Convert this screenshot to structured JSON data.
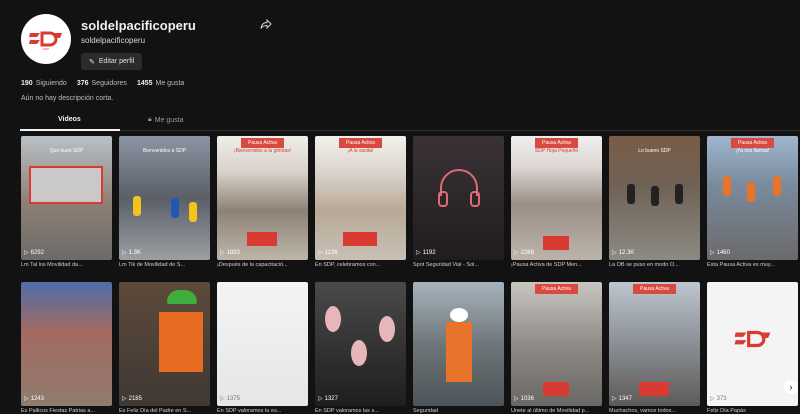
{
  "profile": {
    "username": "soldelpacificoperu",
    "handle": "soldelpacificoperu",
    "avatar_text": "SDP",
    "edit_button": "Editar perfil",
    "stats": [
      {
        "value": "190",
        "label": "Siguiendo"
      },
      {
        "value": "376",
        "label": "Seguidores"
      },
      {
        "value": "1455",
        "label": "Me gusta"
      }
    ],
    "bio": "Aún no hay descripción corta.",
    "icons": {
      "share": "share-icon",
      "edit": "edit-icon"
    }
  },
  "tabs": [
    {
      "label": "Videos",
      "active": true
    },
    {
      "label": "Me gusta",
      "active": false,
      "icon": "lock-icon"
    }
  ],
  "videos": [
    {
      "views": "6292",
      "caption": "Lm Tal los Movilidad da...",
      "banner": "",
      "subtitle": "Qué buen SDP"
    },
    {
      "views": "1.3K",
      "caption": "Lm Tik de Movilidad de S...",
      "banner": "",
      "subtitle": "Bienvenidos a SDP"
    },
    {
      "views": "1893",
      "caption": "¡Después de la capacitació...",
      "banner": "Pausa Activa",
      "subtitle": "¡Bienvenidos a la gimnas!"
    },
    {
      "views": "1136",
      "caption": "En SDP, celebramos con...",
      "banner": "Pausa Activa",
      "subtitle": "¡A la sasita!"
    },
    {
      "views": "1192",
      "caption": "Spot Seguridad Vial - Sol...",
      "banner": "",
      "subtitle": ""
    },
    {
      "views": "2268",
      "caption": "¡Pausa Activa de SDP Men...",
      "banner": "Pausa Activa",
      "subtitle": "SDP Hoja Pequeño"
    },
    {
      "views": "12.3K",
      "caption": "La OB se puso en modo O...",
      "banner": "",
      "subtitle": "Lo bueno SDP"
    },
    {
      "views": "1460",
      "caption": "Esta Pausa Activa es muy...",
      "banner": "Pausa Activa",
      "subtitle": "¡Ya nos llamas!"
    },
    {
      "views": "1243",
      "caption": "Es Pallicos Fiestas Patrias a...",
      "banner": "",
      "subtitle": ""
    },
    {
      "views": "2185",
      "caption": "Es Feliz Día del Padre en S...",
      "banner": "",
      "subtitle": ""
    },
    {
      "views": "1375",
      "caption": "En SDP valoramos tu es...",
      "banner": "",
      "subtitle": ""
    },
    {
      "views": "1327",
      "caption": "En SDP valoramos las s...",
      "banner": "",
      "subtitle": ""
    },
    {
      "views": "",
      "caption": "Seguridad",
      "banner": "",
      "subtitle": ""
    },
    {
      "views": "1036",
      "caption": "Únete al último de Movilidad p...",
      "banner": "Pausa Activa",
      "subtitle": ""
    },
    {
      "views": "1347",
      "caption": "Muchachos, vamos todos...",
      "banner": "Pausa Activa",
      "subtitle": ""
    },
    {
      "views": "373",
      "caption": "Feliz Día Papás",
      "banner": "",
      "subtitle": ""
    }
  ],
  "colors": {
    "brand_red": "#d93a32",
    "background": "#121212"
  }
}
